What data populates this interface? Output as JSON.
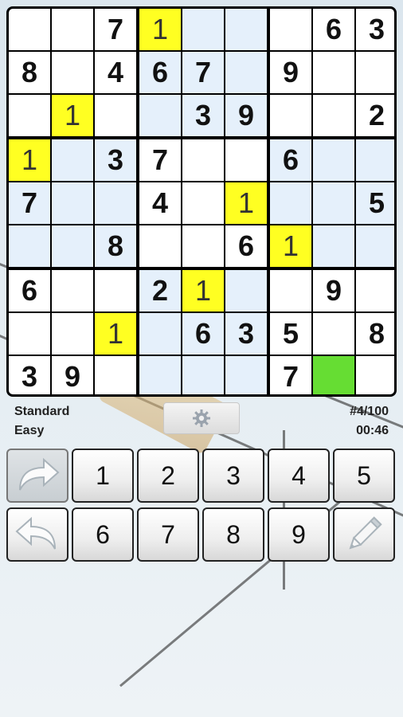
{
  "board": [
    [
      "",
      "",
      "7",
      "1",
      "",
      "",
      "",
      "6",
      "3"
    ],
    [
      "8",
      "",
      "4",
      "6",
      "7",
      "",
      "9",
      "",
      ""
    ],
    [
      "",
      "1",
      "",
      "",
      "3",
      "9",
      "",
      "",
      "2"
    ],
    [
      "1",
      "",
      "3",
      "7",
      "",
      "",
      "6",
      "",
      ""
    ],
    [
      "7",
      "",
      "",
      "4",
      "",
      "1",
      "",
      "",
      "5"
    ],
    [
      "",
      "",
      "8",
      "",
      "",
      "6",
      "1",
      "",
      ""
    ],
    [
      "6",
      "",
      "",
      "2",
      "1",
      "",
      "",
      "9",
      ""
    ],
    [
      "",
      "",
      "1",
      "",
      "6",
      "3",
      "5",
      "",
      "8"
    ],
    [
      "3",
      "9",
      "",
      "",
      "",
      "",
      "7",
      "",
      ""
    ]
  ],
  "highlighted_cells": [
    [
      0,
      3
    ],
    [
      2,
      1
    ],
    [
      3,
      0
    ],
    [
      4,
      5
    ],
    [
      5,
      6
    ],
    [
      6,
      4
    ],
    [
      7,
      2
    ]
  ],
  "selected_cell": [
    8,
    7
  ],
  "colors": {
    "highlight": "#ffff22",
    "selected": "#66dd33",
    "box_light": "#ffffff",
    "box_shaded": "#e5f0fb"
  },
  "status": {
    "mode": "Standard",
    "difficulty": "Easy",
    "puzzle_number": "#4/100",
    "timer": "00:46"
  },
  "settings_icon": "gear-icon",
  "keypad": {
    "row1": [
      "1",
      "2",
      "3",
      "4",
      "5"
    ],
    "row2": [
      "6",
      "7",
      "8",
      "9"
    ],
    "redo_icon": "redo-arrow-icon",
    "undo_icon": "undo-arrow-icon",
    "pencil_icon": "pencil-icon"
  }
}
